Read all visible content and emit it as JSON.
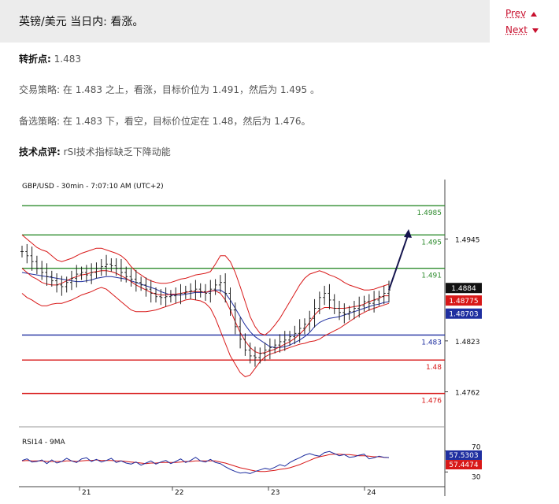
{
  "header": {
    "title": "英镑/美元 当日内: 看涨。"
  },
  "nav": {
    "prev": "Prev",
    "next": "Next"
  },
  "analysis": {
    "pivot_label": "转折点:",
    "pivot_value": "1.483",
    "strategy_label": "交易策略:",
    "strategy_text": "在 1.483 之上，看涨，目标价位为 1.491，然后为 1.495 。",
    "alt_label": "备选策略:",
    "alt_text": "在 1.483 下，看空，目标价位定在 1.48，然后为 1.476。",
    "comment_label": "技术点评:",
    "comment_text": "rSI技术指标缺乏下降动能"
  },
  "chart_data": {
    "type": "line",
    "title": "GBP/USD - 30min - 7:07:10 AM (UTC+2)",
    "ylim": [
      1.472,
      1.5005
    ],
    "y_ticks": [
      "1.4945",
      "1.4823",
      "1.4762"
    ],
    "x_ticks": [
      "21",
      "22",
      "23",
      "24"
    ],
    "levels": [
      {
        "value": 1.4985,
        "label": "1.4985",
        "color": "#2e8b2e"
      },
      {
        "value": 1.495,
        "label": "1.495",
        "color": "#2e8b2e"
      },
      {
        "value": 1.491,
        "label": "1.491",
        "color": "#2e8b2e"
      },
      {
        "value": 1.483,
        "label": "1.483",
        "color": "#1f2fa0"
      },
      {
        "value": 1.48,
        "label": "1.48",
        "color": "#d81818"
      },
      {
        "value": 1.476,
        "label": "1.476",
        "color": "#d81818"
      }
    ],
    "price_boxes": [
      {
        "value": 1.4884,
        "label": "1.4884",
        "color": "#111111"
      },
      {
        "value": 1.48775,
        "label": "1.48775",
        "color": "#d81818"
      },
      {
        "value": 1.48703,
        "label": "1.48703",
        "color": "#1f2fa0"
      }
    ],
    "price_close": [
      1.493,
      1.4925,
      1.4918,
      1.491,
      1.4905,
      1.49,
      1.4895,
      1.489,
      1.4888,
      1.4893,
      1.4898,
      1.4903,
      1.4905,
      1.4902,
      1.4905,
      1.491,
      1.4912,
      1.4915,
      1.4913,
      1.491,
      1.4905,
      1.49,
      1.4897,
      1.4893,
      1.489,
      1.4885,
      1.488,
      1.4876,
      1.4875,
      1.4876,
      1.4877,
      1.4878,
      1.488,
      1.4882,
      1.4883,
      1.4885,
      1.4882,
      1.488,
      1.4885,
      1.489,
      1.4893,
      1.488,
      1.486,
      1.484,
      1.4825,
      1.4812,
      1.4805,
      1.4803,
      1.4808,
      1.4812,
      1.4815,
      1.4818,
      1.4822,
      1.4824,
      1.4828,
      1.4832,
      1.4838,
      1.4843,
      1.485,
      1.4862,
      1.4875,
      1.488,
      1.4872,
      1.4862,
      1.4857,
      1.4855,
      1.4858,
      1.4862,
      1.4865,
      1.487,
      1.4868,
      1.4872,
      1.4876,
      1.488,
      1.4884
    ],
    "sma": [
      1.4905,
      1.4904,
      1.4903,
      1.4902,
      1.4901,
      1.49,
      1.4899,
      1.4898,
      1.4897,
      1.4896,
      1.4895,
      1.4894,
      1.4894,
      1.4895,
      1.4896,
      1.4898,
      1.4899,
      1.49,
      1.49,
      1.4899,
      1.4898,
      1.4897,
      1.4895,
      1.4893,
      1.4891,
      1.4889,
      1.4887,
      1.4885,
      1.4882,
      1.488,
      1.4878,
      1.4878,
      1.4878,
      1.4879,
      1.488,
      1.4881,
      1.4881,
      1.4881,
      1.4882,
      1.4884,
      1.4884,
      1.488,
      1.4872,
      1.4862,
      1.4852,
      1.4842,
      1.4834,
      1.4828,
      1.4824,
      1.482,
      1.4816,
      1.4815,
      1.4815,
      1.4816,
      1.4818,
      1.4821,
      1.4824,
      1.4828,
      1.4833,
      1.484,
      1.4845,
      1.4848,
      1.485,
      1.4851,
      1.4852,
      1.4854,
      1.4856,
      1.4858,
      1.486,
      1.4862,
      1.4864,
      1.4866,
      1.4867,
      1.4869,
      1.487
    ],
    "ema": [
      1.491,
      1.4905,
      1.49,
      1.4897,
      1.4893,
      1.4891,
      1.489,
      1.489,
      1.4892,
      1.4895,
      1.4898,
      1.49,
      1.4902,
      1.4903,
      1.4905,
      1.4906,
      1.4907,
      1.4907,
      1.4906,
      1.4904,
      1.4901,
      1.4898,
      1.4894,
      1.489,
      1.4887,
      1.4884,
      1.4881,
      1.4879,
      1.4878,
      1.4878,
      1.4879,
      1.4879,
      1.488,
      1.4881,
      1.4882,
      1.4882,
      1.4882,
      1.4881,
      1.4883,
      1.4883,
      1.488,
      1.4872,
      1.486,
      1.4846,
      1.4833,
      1.4823,
      1.4815,
      1.481,
      1.4808,
      1.4809,
      1.4811,
      1.4813,
      1.4816,
      1.4819,
      1.4822,
      1.4826,
      1.4831,
      1.4837,
      1.4845,
      1.4854,
      1.486,
      1.4863,
      1.4863,
      1.4862,
      1.4862,
      1.4862,
      1.4863,
      1.4864,
      1.4865,
      1.4867,
      1.487,
      1.4872,
      1.4874,
      1.4877,
      1.4877
    ],
    "bb_upper": [
      1.495,
      1.4945,
      1.494,
      1.4935,
      1.4932,
      1.493,
      1.4925,
      1.492,
      1.4918,
      1.492,
      1.4922,
      1.4925,
      1.4928,
      1.493,
      1.4932,
      1.4934,
      1.4934,
      1.4932,
      1.493,
      1.4928,
      1.4925,
      1.492,
      1.4912,
      1.4906,
      1.4902,
      1.4898,
      1.4895,
      1.4893,
      1.4892,
      1.4892,
      1.4893,
      1.4895,
      1.4897,
      1.4898,
      1.49,
      1.4902,
      1.4903,
      1.4904,
      1.4906,
      1.4915,
      1.4925,
      1.4925,
      1.4918,
      1.4905,
      1.4888,
      1.487,
      1.4852,
      1.484,
      1.4832,
      1.483,
      1.4835,
      1.4842,
      1.485,
      1.486,
      1.487,
      1.488,
      1.489,
      1.4898,
      1.4903,
      1.4905,
      1.4907,
      1.4905,
      1.4902,
      1.49,
      1.4897,
      1.4893,
      1.489,
      1.4888,
      1.4886,
      1.4884,
      1.4884,
      1.4885,
      1.4887,
      1.4889,
      1.4891
    ],
    "bb_lower": [
      1.488,
      1.4875,
      1.4872,
      1.4868,
      1.4865,
      1.4865,
      1.4867,
      1.4868,
      1.4868,
      1.487,
      1.4872,
      1.4875,
      1.4878,
      1.488,
      1.4882,
      1.4885,
      1.4887,
      1.4885,
      1.488,
      1.4875,
      1.487,
      1.4865,
      1.486,
      1.4858,
      1.4858,
      1.4858,
      1.4859,
      1.486,
      1.4862,
      1.4864,
      1.4866,
      1.4868,
      1.487,
      1.4872,
      1.4873,
      1.4872,
      1.4871,
      1.4868,
      1.4862,
      1.485,
      1.4835,
      1.482,
      1.4805,
      1.4795,
      1.4785,
      1.478,
      1.4782,
      1.479,
      1.4798,
      1.4804,
      1.4807,
      1.4809,
      1.4811,
      1.4813,
      1.4815,
      1.4817,
      1.4819,
      1.482,
      1.4822,
      1.4823,
      1.4825,
      1.4829,
      1.4832,
      1.4835,
      1.4838,
      1.4842,
      1.4846,
      1.485,
      1.4854,
      1.4857,
      1.486,
      1.4862,
      1.4864,
      1.4866,
      1.4868
    ],
    "rsi_title": "RSI14 - 9MA",
    "rsi_ylim": [
      20,
      80
    ],
    "rsi_ticks": [
      "70",
      "30"
    ],
    "rsi_boxes": [
      {
        "value": 57.5303,
        "label": "57.5303",
        "color": "#1f2fa0"
      },
      {
        "value": 57.4474,
        "label": "57.4474",
        "color": "#d81818"
      }
    ],
    "rsi": [
      52,
      55,
      49,
      50,
      53,
      46,
      53,
      47,
      50,
      56,
      51,
      48,
      55,
      57,
      50,
      54,
      49,
      52,
      56,
      48,
      51,
      47,
      45,
      49,
      43,
      47,
      51,
      45,
      49,
      52,
      46,
      50,
      55,
      48,
      52,
      58,
      51,
      49,
      54,
      48,
      46,
      40,
      35,
      31,
      28,
      29,
      27,
      31,
      34,
      37,
      35,
      39,
      44,
      41,
      48,
      53,
      57,
      62,
      65,
      62,
      60,
      67,
      69,
      65,
      61,
      63,
      58,
      59,
      62,
      64,
      55,
      57,
      60,
      58,
      57.5
    ],
    "rsi_ma": [
      51,
      52,
      51,
      51,
      51,
      50,
      50,
      50,
      50,
      51,
      51,
      50,
      51,
      52,
      52,
      53,
      52,
      52,
      52,
      51,
      51,
      50,
      49,
      48,
      47,
      46,
      47,
      47,
      48,
      48,
      48,
      48,
      49,
      50,
      50,
      51,
      51,
      51,
      51,
      51,
      49,
      47,
      44,
      41,
      38,
      36,
      34,
      32,
      31,
      31,
      32,
      33,
      35,
      36,
      38,
      41,
      44,
      48,
      52,
      56,
      59,
      61,
      63,
      64,
      64,
      63,
      63,
      62,
      61,
      61,
      60,
      59,
      59,
      58,
      57.4
    ]
  }
}
